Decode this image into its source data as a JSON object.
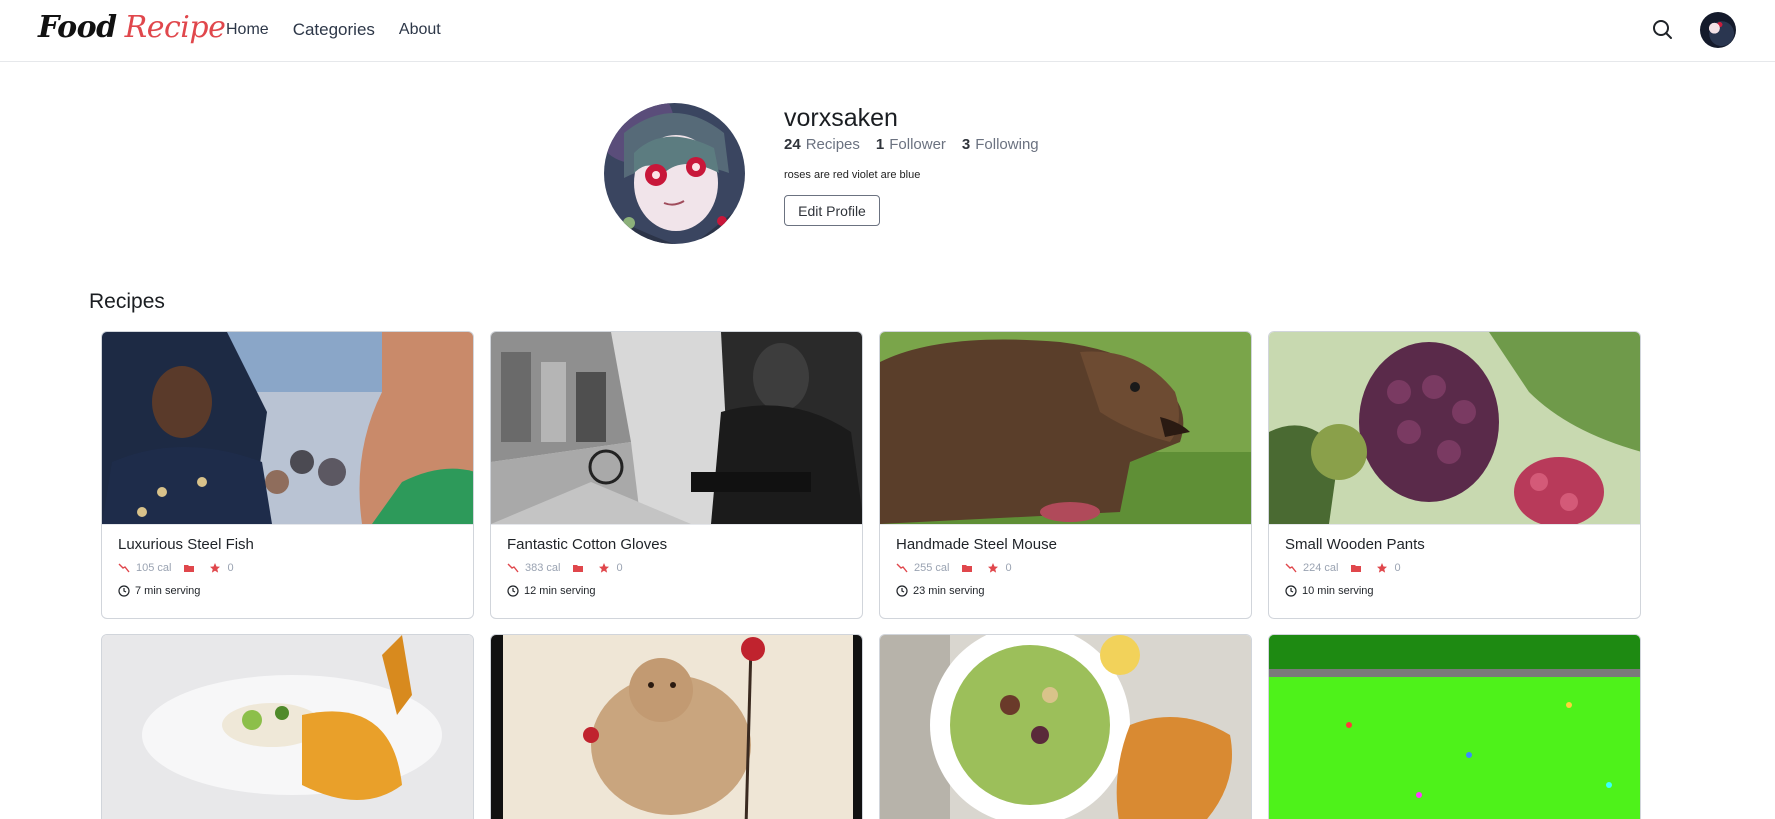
{
  "brand": {
    "part1": "Food",
    "part2": "Recipe"
  },
  "nav": {
    "home": "Home",
    "categories": "Categories",
    "about": "About"
  },
  "profile": {
    "username": "vorxsaken",
    "recipes_count": "24",
    "recipes_label": "Recipes",
    "followers_count": "1",
    "followers_label": "Follower",
    "following_count": "3",
    "following_label": "Following",
    "bio": "roses are red violet are blue",
    "edit_label": "Edit Profile"
  },
  "section": {
    "title": "Recipes"
  },
  "colors": {
    "brand_accent": "#e0474c",
    "meta_icon": "#e0474c",
    "border": "#d1d5db"
  },
  "icons": {
    "search": "search-icon",
    "calorie": "trend-down-icon",
    "category": "folder-icon",
    "rating": "star-icon",
    "time": "clock-icon"
  },
  "recipes": [
    {
      "title": "Luxurious Steel Fish",
      "calories": "105 cal",
      "rating": "0",
      "serving": "7 min serving"
    },
    {
      "title": "Fantastic Cotton Gloves",
      "calories": "383 cal",
      "rating": "0",
      "serving": "12 min serving"
    },
    {
      "title": "Handmade Steel Mouse",
      "calories": "255 cal",
      "rating": "0",
      "serving": "23 min serving"
    },
    {
      "title": "Small Wooden Pants",
      "calories": "224 cal",
      "rating": "0",
      "serving": "10 min serving"
    },
    {
      "title": "",
      "calories": "",
      "rating": "",
      "serving": ""
    },
    {
      "title": "",
      "calories": "",
      "rating": "",
      "serving": ""
    },
    {
      "title": "",
      "calories": "",
      "rating": "",
      "serving": ""
    },
    {
      "title": "",
      "calories": "",
      "rating": "",
      "serving": ""
    }
  ]
}
